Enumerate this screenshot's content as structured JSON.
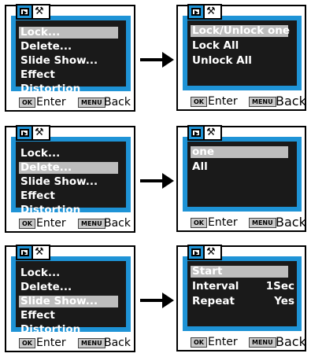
{
  "footer": {
    "ok_key": "OK",
    "ok_label": "Enter",
    "menu_key": "MENU",
    "menu_label": "Back"
  },
  "icons": {
    "playback_tab": "playback-icon",
    "setup_tab": "wrench-icon",
    "arrow": "right-arrow-icon"
  },
  "colors": {
    "screen_border": "#1e93d6",
    "screen_bg": "#1a1a1a",
    "highlight": "#bdbdbd"
  },
  "rows": [
    {
      "left": {
        "items": [
          "Lock...",
          "Delete...",
          "Slide Show...",
          "Effect",
          "Distortion"
        ],
        "selected": 0
      },
      "right": {
        "items": [
          {
            "label": "Lock/Unlock one"
          },
          {
            "label": "Lock All"
          },
          {
            "label": "Unlock All"
          }
        ],
        "selected": 0
      }
    },
    {
      "left": {
        "items": [
          "Lock...",
          "Delete...",
          "Slide Show...",
          "Effect",
          "Distortion"
        ],
        "selected": 1
      },
      "right": {
        "items": [
          {
            "label": "one"
          },
          {
            "label": "All"
          }
        ],
        "selected": 0
      }
    },
    {
      "left": {
        "items": [
          "Lock...",
          "Delete...",
          "Slide Show...",
          "Effect",
          "Distortion"
        ],
        "selected": 2
      },
      "right": {
        "items": [
          {
            "label": "Start"
          },
          {
            "label": "Interval",
            "value": "1Sec"
          },
          {
            "label": "Repeat",
            "value": "Yes"
          }
        ],
        "selected": 0
      }
    }
  ]
}
